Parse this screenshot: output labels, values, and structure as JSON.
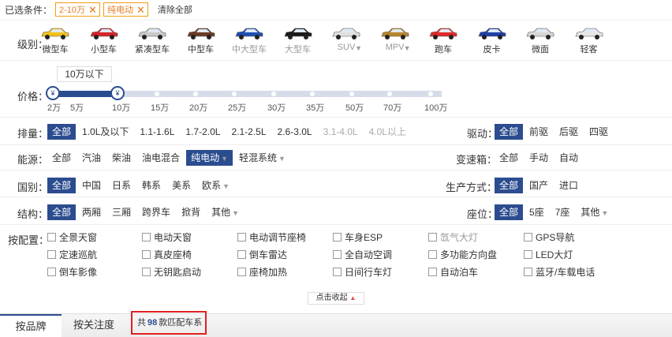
{
  "selected": {
    "label": "已选条件：",
    "chips": [
      "2-10万",
      "纯电动"
    ],
    "clear_all": "清除全部"
  },
  "level": {
    "label": "级别：",
    "items": [
      {
        "name": "微型车",
        "color": "#f2c21b"
      },
      {
        "name": "小型车",
        "color": "#d6252a"
      },
      {
        "name": "紧凑型车",
        "color": "#c9c9c9"
      },
      {
        "name": "中型车",
        "color": "#6b3a26"
      },
      {
        "name": "中大型车",
        "color": "#1f4fb3"
      },
      {
        "name": "大型车",
        "color": "#1a1a1a"
      },
      {
        "name": "SUV",
        "color": "#e0e0e0"
      },
      {
        "name": "MPV",
        "color": "#b8862b"
      },
      {
        "name": "跑车",
        "color": "#e02a2a"
      },
      {
        "name": "皮卡",
        "color": "#1f3fa8"
      },
      {
        "name": "微面",
        "color": "#d8d8d8"
      },
      {
        "name": "轻客",
        "color": "#e6e6e6"
      }
    ]
  },
  "price": {
    "label": "价格：",
    "tip": "10万以下",
    "handle_icon": "¥",
    "ticks": [
      "2万",
      "5万",
      "10万",
      "15万",
      "20万",
      "25万",
      "30万",
      "35万",
      "50万",
      "70万",
      "100万"
    ],
    "range": [
      2,
      10
    ]
  },
  "displacement": {
    "label": "排量：",
    "options": [
      "全部",
      "1.0L及以下",
      "1.1-1.6L",
      "1.7-2.0L",
      "2.1-2.5L",
      "2.6-3.0L",
      "3.1-4.0L",
      "4.0L以上"
    ]
  },
  "drive": {
    "label": "驱动：",
    "options": [
      "全部",
      "前驱",
      "后驱",
      "四驱"
    ]
  },
  "energy": {
    "label": "能源：",
    "options": [
      "全部",
      "汽油",
      "柴油",
      "油电混合",
      "纯电动",
      "轻混系统"
    ]
  },
  "gearbox": {
    "label": "变速箱：",
    "options": [
      "全部",
      "手动",
      "自动"
    ]
  },
  "country": {
    "label": "国别：",
    "options": [
      "全部",
      "中国",
      "日系",
      "韩系",
      "美系",
      "欧系"
    ]
  },
  "production": {
    "label": "生产方式：",
    "options": [
      "全部",
      "国产",
      "进口"
    ]
  },
  "structure": {
    "label": "结构：",
    "options": [
      "全部",
      "两厢",
      "三厢",
      "跨界车",
      "掀背",
      "其他"
    ]
  },
  "seats": {
    "label": "座位：",
    "options": [
      "全部",
      "5座",
      "7座",
      "其他"
    ]
  },
  "config": {
    "label": "按配置：",
    "items": [
      "全景天窗",
      "电动天窗",
      "电动调节座椅",
      "车身ESP",
      "氙气大灯",
      "GPS导航",
      "定速巡航",
      "真皮座椅",
      "倒车雷达",
      "全自动空调",
      "多功能方向盘",
      "LED大灯",
      "倒车影像",
      "无钥匙启动",
      "座椅加热",
      "日间行车灯",
      "自动泊车",
      "蓝牙/车载电话"
    ]
  },
  "collapse": "点击收起",
  "bottom": {
    "tabs": [
      "按品牌",
      "按关注度"
    ],
    "count_prefix": "共",
    "count": "98",
    "count_suffix": "款匹配车系"
  }
}
